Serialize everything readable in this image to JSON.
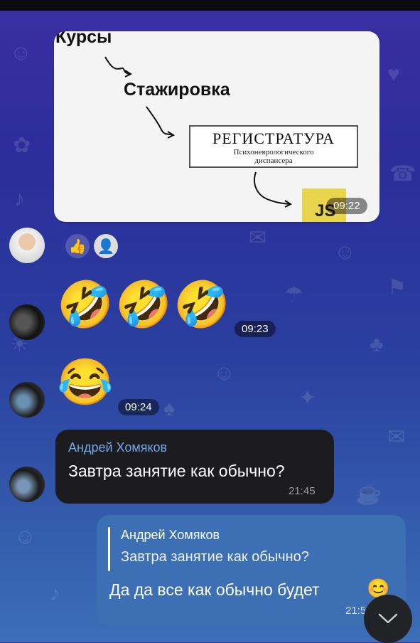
{
  "image_message": {
    "kursy": "Курсы",
    "stazhirovka": "Стажировка",
    "registratura_title": "РЕГИСТРАТУРА",
    "registratura_sub1": "Психоневрологического",
    "registratura_sub2": "диспансера",
    "js_logo": "JS",
    "time": "09:22"
  },
  "reactions": [
    {
      "icon": "thumbs-up-icon",
      "glyph": "👍"
    },
    {
      "icon": "reactor-avatar",
      "glyph": "👤"
    }
  ],
  "emoji_message_1": {
    "emoji": "🤣",
    "count": 3,
    "time": "09:23"
  },
  "emoji_message_2": {
    "emoji": "😂",
    "time": "09:24"
  },
  "incoming_message": {
    "sender": "Андрей Хомяков",
    "text": "Завтра занятие как обычно?",
    "time": "21:45"
  },
  "outgoing_message": {
    "reply_sender": "Андрей Хомяков",
    "reply_text": "Завтра занятие как обычно?",
    "text": "Да да все как обычно будет",
    "emoji": "😊",
    "time": "21:5"
  },
  "colors": {
    "incoming_bubble": "#1c1c1e",
    "outgoing_bubble": "#3d6fb5",
    "sender_name": "#6ea8f0"
  }
}
